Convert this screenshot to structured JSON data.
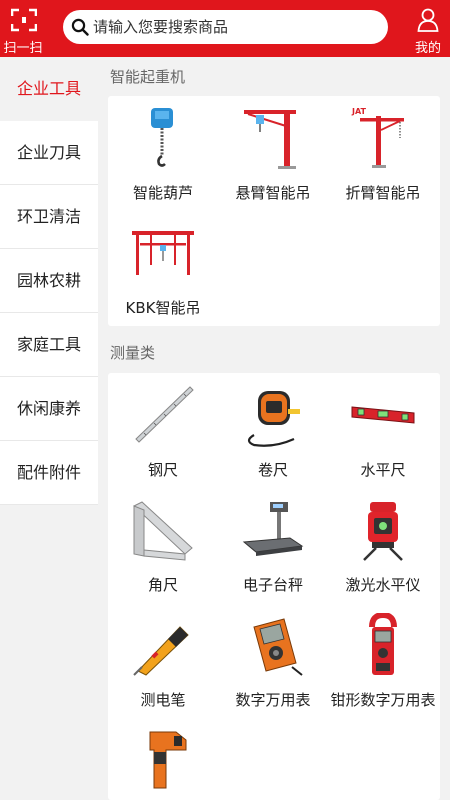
{
  "header": {
    "scan_label": "扫一扫",
    "search_placeholder": "请输入您要搜索商品",
    "mine_label": "我的",
    "accent_color": "#e0161c"
  },
  "sidebar": {
    "items": [
      {
        "label": "企业工具",
        "active": true
      },
      {
        "label": "企业刀具",
        "active": false
      },
      {
        "label": "环卫清洁",
        "active": false
      },
      {
        "label": "园林农耕",
        "active": false
      },
      {
        "label": "家庭工具",
        "active": false
      },
      {
        "label": "休闲康养",
        "active": false
      },
      {
        "label": "配件附件",
        "active": false
      }
    ]
  },
  "sections": [
    {
      "title": "智能起重机",
      "products": [
        {
          "name": "智能葫芦",
          "icon": "electric-hoist-icon"
        },
        {
          "name": "悬臂智能吊",
          "icon": "jib-crane-icon"
        },
        {
          "name": "折臂智能吊",
          "icon": "folding-arm-crane-icon"
        },
        {
          "name": "KBK智能吊",
          "icon": "kbk-crane-icon"
        }
      ]
    },
    {
      "title": "测量类",
      "products": [
        {
          "name": "钢尺",
          "icon": "steel-ruler-icon"
        },
        {
          "name": "卷尺",
          "icon": "tape-measure-icon"
        },
        {
          "name": "水平尺",
          "icon": "spirit-level-icon"
        },
        {
          "name": "角尺",
          "icon": "angle-square-icon"
        },
        {
          "name": "电子台秤",
          "icon": "platform-scale-icon"
        },
        {
          "name": "激光水平仪",
          "icon": "laser-level-icon"
        },
        {
          "name": "测电笔",
          "icon": "voltage-tester-pen-icon"
        },
        {
          "name": "数字万用表",
          "icon": "digital-multimeter-icon"
        },
        {
          "name": "钳形数字万用表",
          "icon": "clamp-meter-icon"
        },
        {
          "name": "",
          "icon": "infrared-thermometer-icon"
        }
      ]
    }
  ]
}
